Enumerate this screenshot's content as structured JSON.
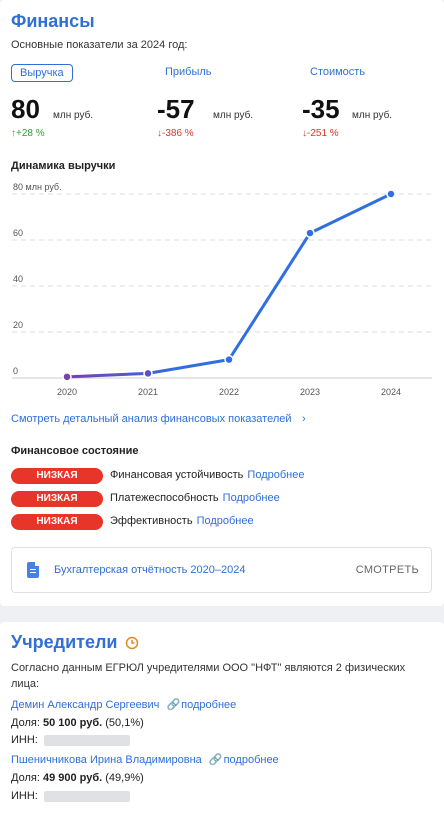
{
  "finances": {
    "title": "Финансы",
    "subtitle": "Основные показатели за 2024 год:",
    "metrics": [
      {
        "label": "Выручка",
        "value": "80",
        "unit": "млн руб.",
        "change": "↑+28 %",
        "direction": "up"
      },
      {
        "label": "Прибыль",
        "value": "-57",
        "unit": "млн руб.",
        "change": "↓-386 %",
        "direction": "down"
      },
      {
        "label": "Стоимость",
        "value": "-35",
        "unit": "млн руб.",
        "change": "↓-251 %",
        "direction": "down"
      }
    ],
    "chart_title": "Динамика выручки",
    "detail_link": "Смотреть детальный анализ финансовых показателей",
    "detail_arrow": "›",
    "status_title": "Финансовое состояние",
    "status": [
      {
        "badge": "НИЗКАЯ",
        "label": "Финансовая устойчивость",
        "link": "Подробнее"
      },
      {
        "badge": "НИЗКАЯ",
        "label": "Платежеспособность",
        "link": "Подробнее"
      },
      {
        "badge": "НИЗКАЯ",
        "label": "Эффективность",
        "link": "Подробнее"
      }
    ],
    "report": {
      "title": "Бухгалтерская отчётность 2020–2024",
      "button": "СМОТРЕТЬ"
    }
  },
  "chart_data": {
    "type": "line",
    "title": "Динамика выручки",
    "x": [
      "2020",
      "2021",
      "2022",
      "2023",
      "2024"
    ],
    "values": [
      0.5,
      2,
      8,
      63,
      80
    ],
    "ylim": [
      0,
      80
    ],
    "yticks": [
      "0",
      "20",
      "40",
      "60",
      "80 млн руб."
    ],
    "grid": true,
    "colors": {
      "start": "#7b3fb0",
      "end": "#2f6fe0"
    }
  },
  "founders": {
    "title": "Учредители",
    "icon": "clock-icon",
    "text": "Согласно данным ЕГРЮЛ учредителями ООО \"НФТ\" являются 2 физических лица:",
    "people": [
      {
        "name": "Демин Александр Сергеевич",
        "more": "подробнее",
        "share_label": "Доля:",
        "share_value": "50 100 руб.",
        "share_pct": "(50,1%)",
        "inn_label": "ИНН:"
      },
      {
        "name": "Пшеничникова Ирина Владимировна",
        "more": "подробнее",
        "share_label": "Доля:",
        "share_value": "49 900 руб.",
        "share_pct": "(49,9%)",
        "inn_label": "ИНН:"
      }
    ]
  },
  "colors": {
    "accent": "#2f6fd6",
    "up": "#2e9e33",
    "down": "#d9362b",
    "badge": "#e8352a"
  }
}
